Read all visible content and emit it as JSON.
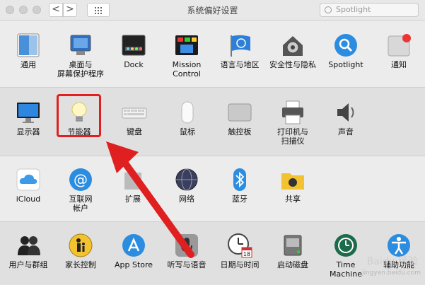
{
  "window": {
    "title": "系统偏好设置",
    "search_placeholder": "Spotlight"
  },
  "nav": {
    "back": "<",
    "forward": ">"
  },
  "rows": [
    {
      "items": [
        {
          "id": "general",
          "label": "通用"
        },
        {
          "id": "desktop",
          "label": "桌面与\n屏幕保护程序"
        },
        {
          "id": "dock",
          "label": "Dock"
        },
        {
          "id": "mission",
          "label": "Mission\nControl"
        },
        {
          "id": "language",
          "label": "语言与地区"
        },
        {
          "id": "security",
          "label": "安全性与隐私"
        },
        {
          "id": "spotlight",
          "label": "Spotlight"
        },
        {
          "id": "notifications",
          "label": "通知"
        }
      ]
    },
    {
      "items": [
        {
          "id": "displays",
          "label": "显示器"
        },
        {
          "id": "energy",
          "label": "节能器"
        },
        {
          "id": "keyboard",
          "label": "键盘"
        },
        {
          "id": "mouse",
          "label": "鼠标"
        },
        {
          "id": "trackpad",
          "label": "触控板"
        },
        {
          "id": "printers",
          "label": "打印机与\n扫描仪"
        },
        {
          "id": "sound",
          "label": "声音"
        }
      ]
    },
    {
      "items": [
        {
          "id": "icloud",
          "label": "iCloud"
        },
        {
          "id": "internet",
          "label": "互联网\n帐户"
        },
        {
          "id": "extensions",
          "label": "扩展"
        },
        {
          "id": "network",
          "label": "网络"
        },
        {
          "id": "bluetooth",
          "label": "蓝牙"
        },
        {
          "id": "sharing",
          "label": "共享"
        }
      ]
    },
    {
      "items": [
        {
          "id": "users",
          "label": "用户与群组"
        },
        {
          "id": "parental",
          "label": "家长控制"
        },
        {
          "id": "appstore",
          "label": "App Store"
        },
        {
          "id": "dictation",
          "label": "听写与语音"
        },
        {
          "id": "datetime",
          "label": "日期与时间"
        },
        {
          "id": "startup",
          "label": "启动磁盘"
        },
        {
          "id": "timemachine",
          "label": "Time Machine"
        },
        {
          "id": "accessibility",
          "label": "辅助功能"
        }
      ]
    }
  ],
  "calendar_day": "18",
  "watermark": {
    "main": "Baidu 经验",
    "url": "jingyan.baidu.com"
  },
  "colors": {
    "highlight": "#e02020",
    "arrow": "#e02020"
  }
}
